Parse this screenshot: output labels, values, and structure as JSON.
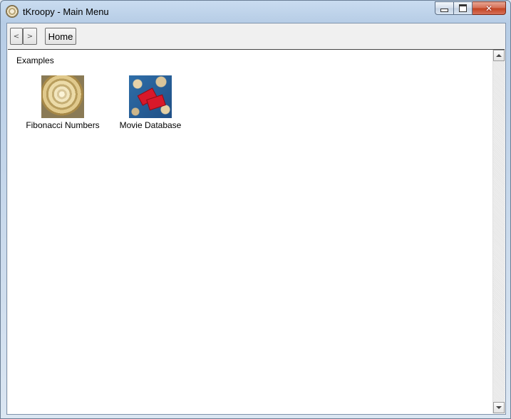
{
  "window": {
    "title": "tKroopy - Main Menu",
    "controls": {
      "minimize": "minimize-icon",
      "maximize": "maximize-icon",
      "close": "✕"
    }
  },
  "toolbar": {
    "back_label": "<",
    "forward_label": ">",
    "home_label": "Home"
  },
  "content": {
    "section_label": "Examples",
    "items": [
      {
        "label": "Fibonacci Numbers",
        "icon": "snail-shell-image"
      },
      {
        "label": "Movie Database",
        "icon": "movie-tickets-image"
      }
    ]
  },
  "colors": {
    "title_bar": "#c9dcf0",
    "close_button": "#c2411f",
    "content_background": "#ffffff"
  }
}
